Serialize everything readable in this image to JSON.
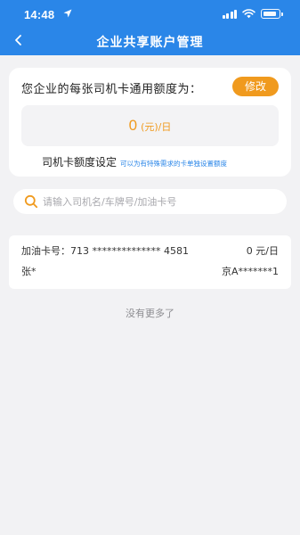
{
  "status_bar": {
    "time": "14:48"
  },
  "nav": {
    "title": "企业共享账户管理"
  },
  "quota": {
    "label": "您企业的每张司机卡通用额度为：",
    "edit_label": "修改",
    "amount": "0",
    "unit": "(元)/日",
    "setting_label": "司机卡额度设定",
    "setting_hint": "可以为有特殊需求的卡单独设置额度"
  },
  "search": {
    "placeholder": "请输入司机名/车牌号/加油卡号"
  },
  "card_list": [
    {
      "card_label": "加油卡号：713 ************** 4581",
      "limit": "0 元/日",
      "driver": "张*",
      "plate": "京A*******1"
    }
  ],
  "list_footer": "没有更多了",
  "colors": {
    "primary": "#2a86e8",
    "accent": "#f09a1e",
    "background": "#f2f2f4"
  }
}
